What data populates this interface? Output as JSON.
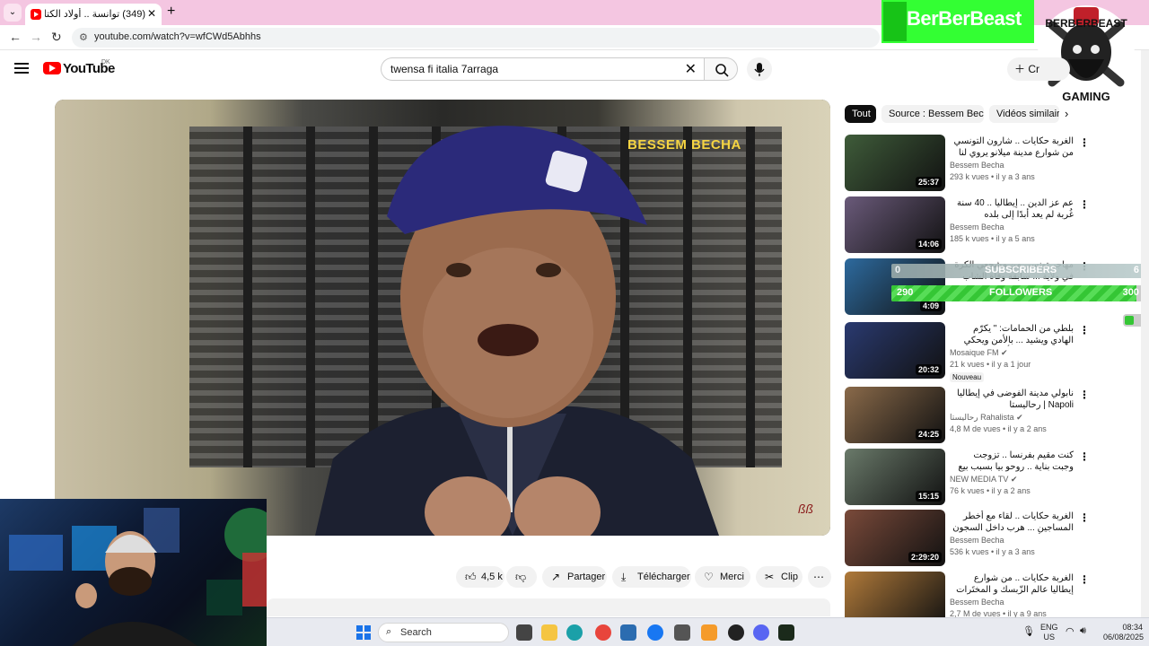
{
  "browser": {
    "tab_title": "(349) توانسة .. أولاد الكتارية",
    "url": "youtube.com/watch?v=wfCWd5Abhhs",
    "new_tab_label": "+"
  },
  "overlay": {
    "logo_text": "BerBerBeast",
    "badge_text": "GAMING",
    "badge_top": "BERBERBEAST",
    "subscribers_label": "SUBSCRIBERS",
    "subscribers_current": "0",
    "subscribers_goal": "6",
    "subscribers_progress": 0,
    "followers_label": "FOLLOWERS",
    "followers_current": "290",
    "followers_goal": "300",
    "followers_progress": 0.967
  },
  "youtube": {
    "wordmark": "YouTube",
    "country": "DK",
    "search_value": "twensa fi italia 7arraga",
    "create_label": "Cr",
    "video_brand": "BESSEM BECHA"
  },
  "actions": {
    "likes": "4,5 k",
    "share": "Partager",
    "download": "Télécharger",
    "thanks": "Merci",
    "clip": "Clip"
  },
  "chips": [
    {
      "label": "Tout",
      "active": true
    },
    {
      "label": "Source : Bessem Becha",
      "active": false
    },
    {
      "label": "Vidéos similaires",
      "active": false
    }
  ],
  "recommendations": [
    {
      "title": "الغربة حكايات .. شارون التونسي من شوارع مدينة ميلانو يروي لنا مغامراته مع البوليس",
      "channel": "Bessem Becha",
      "meta": "293 k vues • il y a 3 ans",
      "duration": "25:37",
      "verified": false,
      "badge": "",
      "thumb": "#3f5c3a"
    },
    {
      "title": "عم عز الدين .. إيطاليا .. 40 سنة غُربة لم يعد أبدًا إلى بلده",
      "channel": "Bessem Becha",
      "meta": "185 k vues • il y a 5 ans",
      "duration": "14:06",
      "verified": false,
      "badge": "",
      "thumb": "#6a5a7a"
    },
    {
      "title": "مهاجر تونسي من مشجعي الكرة في ولاية ... سابقة وفاة الشاب سحط ملوثة وصل ... متهم",
      "channel": "",
      "meta": "K vues",
      "duration": "4:09",
      "verified": false,
      "badge": "",
      "thumb": "#2d6a9e"
    },
    {
      "title": "بلطي من الحمامات: \" يكرّم الهادي ويشيد ... بالأمن ويحكي لفلسطين ويرفع بأفكار الاعتزال",
      "channel": "Mosaique FM",
      "meta": "21 k vues • il y a 1 jour",
      "duration": "20:32",
      "verified": true,
      "badge": "Nouveau",
      "thumb": "#2a3a70"
    },
    {
      "title": "نابولي مدينة الفوضى في إيطاليا Napoli | رحاليستا",
      "channel": "رحاليستا Rahalista",
      "meta": "4,8 M de vues • il y a 2 ans",
      "duration": "24:25",
      "verified": true,
      "badge": "",
      "thumb": "#8a6a4a"
    },
    {
      "title": "كنت مقيم بفرنسا .. تزوجت وجبت بناية .. روحو بيا بسبب بيع المخدرات ومرتي TN FR",
      "channel": "NEW MEDIA TV",
      "meta": "76 k vues • il y a 2 ans",
      "duration": "15:15",
      "verified": true,
      "badge": "",
      "thumb": "#6a7a6a"
    },
    {
      "title": "الغربة حكايات .. لقاء مع أخطر المساجين ... هرب داخل السجون الإيطالية أغلبية قضاياهم",
      "channel": "Bessem Becha",
      "meta": "536 k vues • il y a 3 ans",
      "duration": "2:29:20",
      "verified": false,
      "badge": "",
      "thumb": "#7a4a3a"
    },
    {
      "title": "الغربة حكايات .. من شوارع إيطاليا عالم الزّبسك و المختَرات و لقاء مع بعض ممّن",
      "channel": "Bessem Becha",
      "meta": "2,7 M de vues • il y a 9 ans",
      "duration": "",
      "verified": false,
      "badge": "",
      "thumb": "#b07a3a"
    }
  ],
  "taskbar": {
    "search_label": "Search",
    "lang_1": "ENG",
    "lang_2": "US",
    "time": "08:34",
    "date": "06/08/2025"
  }
}
